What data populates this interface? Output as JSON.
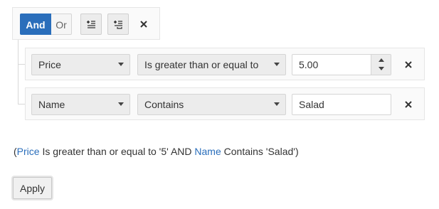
{
  "toolbar": {
    "logic_and_label": "And",
    "logic_or_label": "Or",
    "selected_logic": "And",
    "add_expression_icon": "add-expression-icon",
    "add_group_icon": "add-group-icon",
    "close_icon": "close-icon"
  },
  "expressions": [
    {
      "field": "Price",
      "operator": "Is greater than or equal to",
      "value": "5.00",
      "editor": "numeric"
    },
    {
      "field": "Name",
      "operator": "Contains",
      "value": "Salad",
      "editor": "text"
    }
  ],
  "summary": {
    "open_paren": "(",
    "field_1": "Price",
    "clause_1": " Is greater than or equal to '5' ",
    "joiner": "AND",
    "field_2": "Name",
    "clause_2": " Contains 'Salad'",
    "close_paren": ")"
  },
  "apply_label": "Apply",
  "colors": {
    "accent": "#2a6ebb",
    "field_link": "#2a6ebb"
  }
}
